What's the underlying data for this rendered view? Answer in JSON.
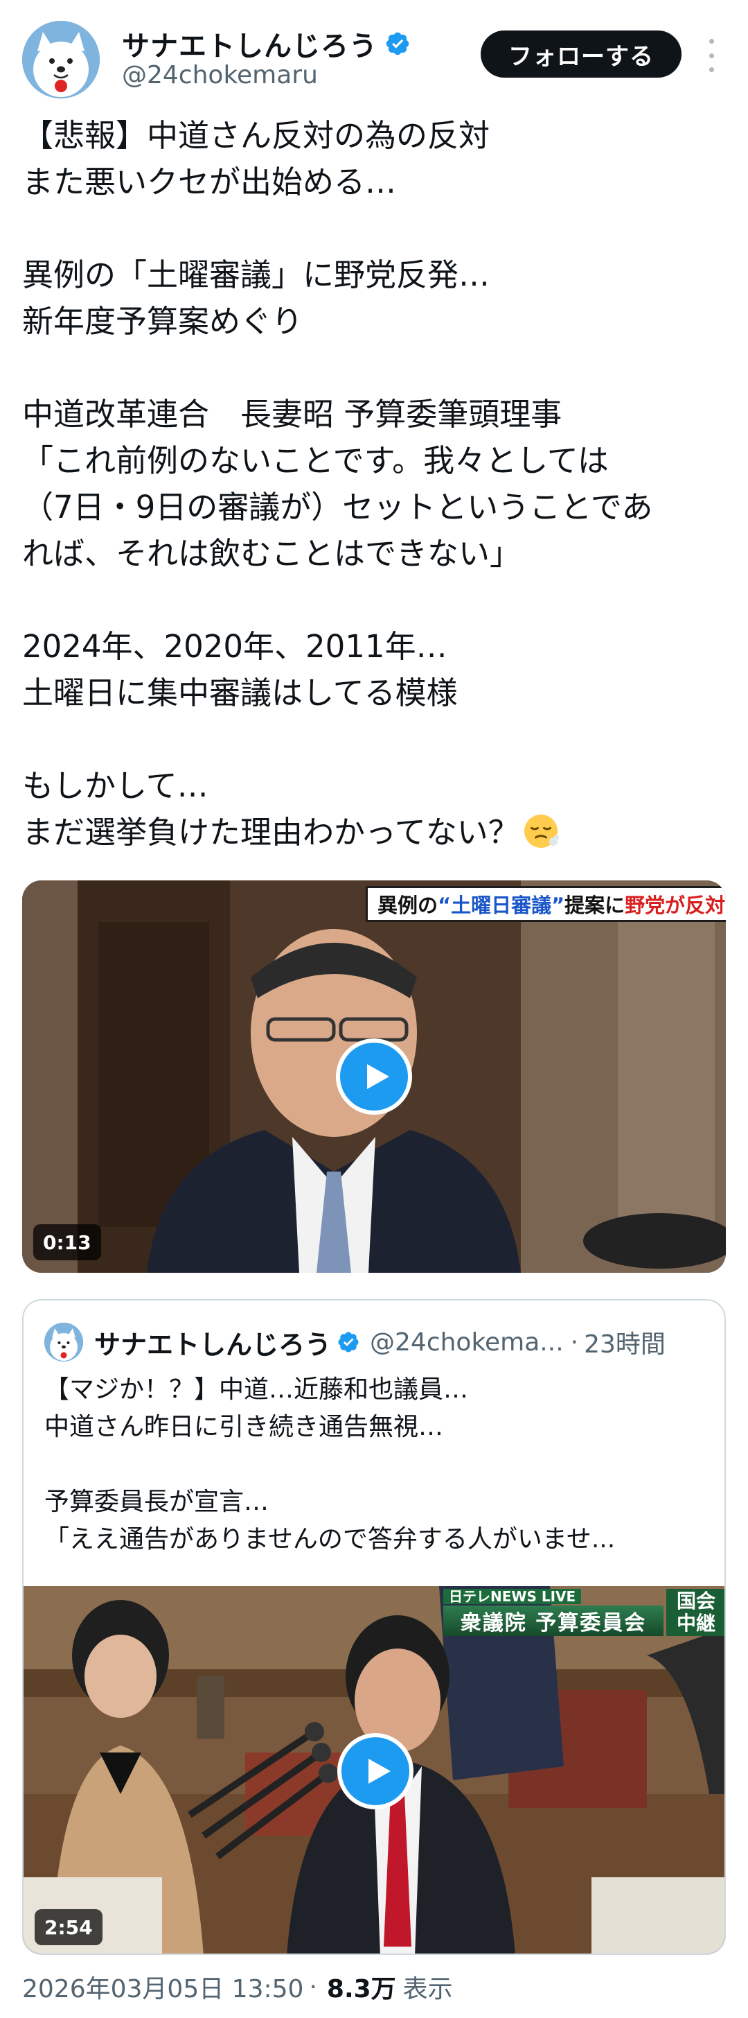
{
  "author": {
    "name": "サナエトしんじろう",
    "handle": "@24chokemaru",
    "verified": true
  },
  "actions": {
    "follow_label": "フォローする",
    "more_icon": "more-vertical-icon"
  },
  "tweet": {
    "lines": [
      "【悲報】中道さん反対の為の反対",
      "また悪いクセが出始める…",
      "",
      "異例の「土曜審議」に野党反発…",
      "新年度予算案めぐり",
      "",
      "中道改革連合　長妻昭 予算委筆頭理事",
      "「これ前例のないことです。我々としては",
      "（7日・9日の審議が）セットということであ",
      "れば、それは飲むことはできない」",
      "",
      "2024年、2020年、2011年…",
      "土曜日に集中審議はしてる模様",
      "",
      "もしかして…",
      "まだ選挙負けた理由わかってない？"
    ],
    "trailing_emoji": "face-exhaling-emoji"
  },
  "media": {
    "banner": {
      "part1": "異例の",
      "part2": "“土曜日審議”",
      "part3": "提案に",
      "part4": "野党が反対"
    },
    "duration": "0:13"
  },
  "quote": {
    "name": "サナエトしんじろう",
    "handle": "@24chokema...",
    "dot": "·",
    "time": "23時間",
    "lines": [
      "【マジか！？】中道…近藤和也議員…",
      "中道さん昨日に引き続き通告無視…",
      "",
      "予算委員長が宣言…",
      "「ええ通告がありませんので答弁する人がいませ..."
    ],
    "media": {
      "live_label": "日テレNEWS LIVE",
      "caption": "衆議院 予算委員会",
      "tag_line1": "国会",
      "tag_line2": "中継",
      "duration": "2:54"
    }
  },
  "footer": {
    "datetime": "2026年03月05日 13:50",
    "sep": "·",
    "views": "8.3万",
    "views_label": "表示"
  },
  "colors": {
    "accent": "#1d9bf0",
    "text": "#0f1419",
    "secondary": "#536471",
    "border": "#cfd9de"
  }
}
